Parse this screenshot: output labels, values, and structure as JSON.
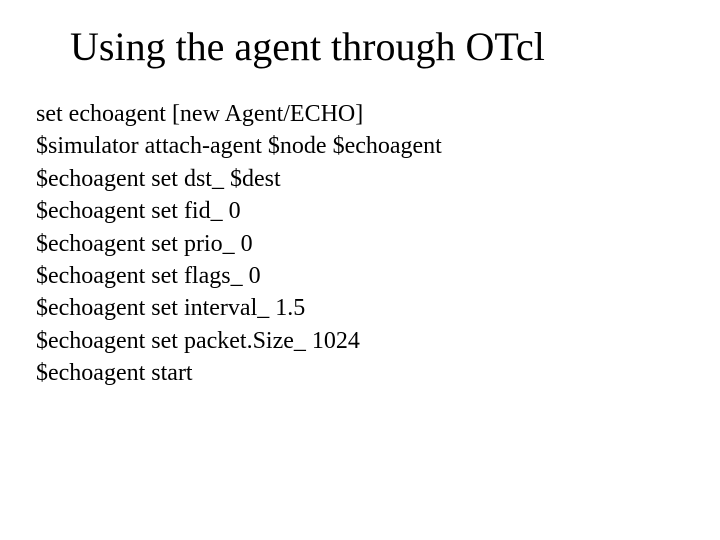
{
  "title": "Using the agent through OTcl",
  "code_lines": [
    "set echoagent [new Agent/ECHO]",
    "$simulator attach-agent $node $echoagent",
    "$echoagent set dst_ $dest",
    "$echoagent set fid_ 0",
    "$echoagent set prio_ 0",
    "$echoagent set flags_ 0",
    "$echoagent set interval_ 1.5",
    "$echoagent set packet.Size_ 1024",
    "$echoagent start"
  ]
}
